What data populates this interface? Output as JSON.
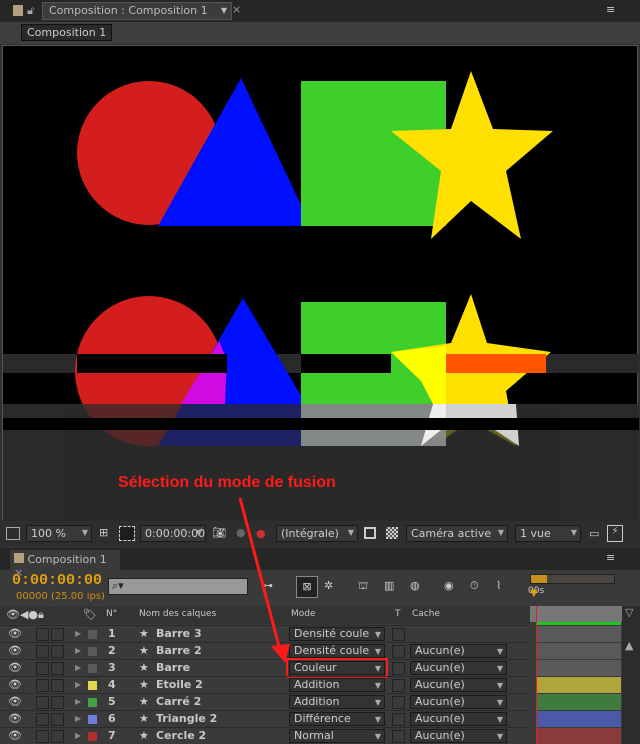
{
  "viewer_panel": {
    "tab_title": "Composition : Composition 1",
    "sub_tab": "Composition 1"
  },
  "annotation": {
    "text": "Sélection du mode de fusion",
    "color": "#ff1a1a"
  },
  "viewer_toolbar": {
    "zoom": "100 %",
    "timecode": "0:00:00:00",
    "resolution": "(Intégrale)",
    "camera": "Caméra active",
    "views": "1 vue"
  },
  "timeline": {
    "tab_title": "Composition 1",
    "timecode": "0:00:00:00",
    "frame_info": "00000 (25.00 ips)",
    "search_placeholder": "",
    "ruler_label": "00s",
    "headers": {
      "num": "N°",
      "name": "Nom des calques",
      "mode": "Mode",
      "t": "T",
      "cache": "Cache"
    },
    "layers": [
      {
        "num": "1",
        "name": "Barre 3",
        "mode": "Densité couleur",
        "cache": "",
        "color": "#5a5a5a",
        "track": "#5a5a5a"
      },
      {
        "num": "2",
        "name": "Barre 2",
        "mode": "Densité couleur",
        "cache": "Aucun(e)",
        "color": "#5a5a5a",
        "track": "#5a5a5a"
      },
      {
        "num": "3",
        "name": "Barre",
        "mode": "Couleur",
        "cache": "Aucun(e)",
        "color": "#5a5a5a",
        "track": "#5a5a5a",
        "highlighted": true
      },
      {
        "num": "4",
        "name": "Etoile 2",
        "mode": "Addition",
        "cache": "Aucun(e)",
        "color": "#e0d84a",
        "track": "#b0a53c"
      },
      {
        "num": "5",
        "name": "Carré 2",
        "mode": "Addition",
        "cache": "Aucun(e)",
        "color": "#44a044",
        "track": "#3f7a3f"
      },
      {
        "num": "6",
        "name": "Triangle 2",
        "mode": "Différence",
        "cache": "Aucun(e)",
        "color": "#6a7fe0",
        "track": "#4a5aa8"
      },
      {
        "num": "7",
        "name": "Cercle 2",
        "mode": "Normal",
        "cache": "Aucun(e)",
        "color": "#b03030",
        "track": "#8a3a3a"
      }
    ]
  }
}
